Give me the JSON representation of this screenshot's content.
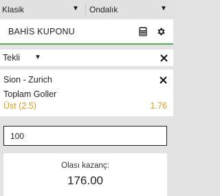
{
  "topbar": {
    "format_selected": "Klasik",
    "odds_selected": "Ondalık"
  },
  "header": {
    "title": "BAHİS KUPONU",
    "icons": [
      "calculator-icon",
      "gear-icon"
    ]
  },
  "mode": {
    "selected": "Tekli"
  },
  "bet": {
    "match": "Sion - Zurich",
    "market": "Toplam Goller",
    "selection": "Üst (2.5)",
    "odds": "1.76",
    "selection_color": "#e09b1e"
  },
  "stake": {
    "value": "100"
  },
  "payout": {
    "label": "Olası kazanç:",
    "value": "176.00"
  },
  "colors": {
    "accent_green": "#4caf50",
    "background": "#e3e3e3"
  }
}
